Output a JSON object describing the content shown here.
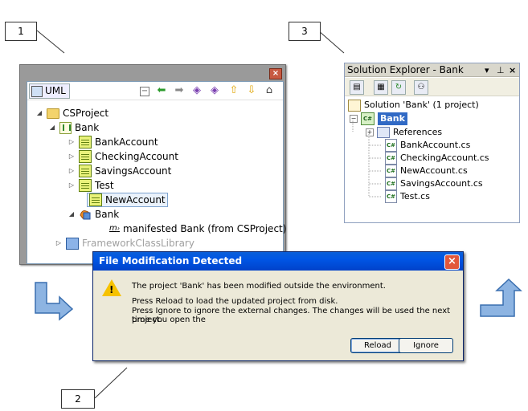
{
  "callouts": {
    "one": "1",
    "two": "2",
    "three": "3"
  },
  "uml": {
    "tab_label": "UML",
    "tree": {
      "project": "CSProject",
      "package": "Bank",
      "classes": [
        "BankAccount",
        "CheckingAccount",
        "SavingsAccount",
        "Test",
        "NewAccount"
      ],
      "component": "Bank",
      "manifest": "manifested Bank (from CSProject)",
      "manifest_prefix": "m",
      "library": "FrameworkClassLibrary"
    },
    "toolbar_icons": [
      "collapse-icon",
      "back-arrow-icon",
      "forward-arrow-icon",
      "link-icon",
      "link2-icon",
      "up-arrow-icon",
      "down-arrow-icon",
      "home-icon"
    ]
  },
  "solution_explorer": {
    "title": "Solution Explorer - Bank",
    "solution_label": "Solution 'Bank' (1 project)",
    "project": "Bank",
    "references": "References",
    "files": [
      "BankAccount.cs",
      "CheckingAccount.cs",
      "NewAccount.cs",
      "SavingsAccount.cs",
      "Test.cs"
    ]
  },
  "dialog": {
    "title": "File Modification Detected",
    "line1": "The project 'Bank' has been modified outside the environment.",
    "line2": "Press Reload to load the updated project from disk.",
    "line3": "Press Ignore to ignore the external changes. The changes will be used the next time you open the",
    "line4": "project.",
    "reload_label": "Reload",
    "ignore_label": "Ignore"
  },
  "colors": {
    "title_blue": "#0055e5",
    "selection_blue": "#316ac5",
    "arrow_blue": "#8db4e2"
  }
}
